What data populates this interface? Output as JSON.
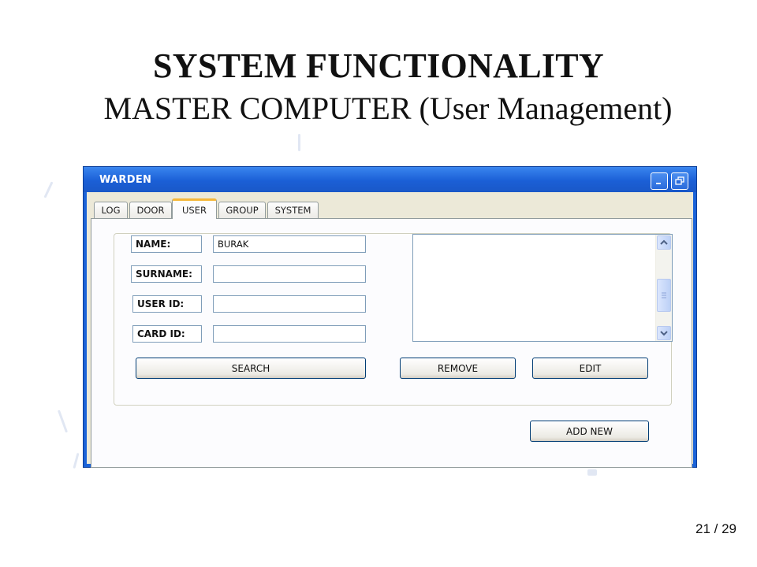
{
  "slide": {
    "title": "SYSTEM FUNCTIONALITY",
    "subtitle": "MASTER COMPUTER (User Management)",
    "page_number": "21 / 29"
  },
  "window": {
    "title": "WARDEN",
    "tabs": [
      {
        "label": "LOG",
        "active": false
      },
      {
        "label": "DOOR",
        "active": false
      },
      {
        "label": "USER",
        "active": true
      },
      {
        "label": "GROUP",
        "active": false
      },
      {
        "label": "SYSTEM",
        "active": false
      }
    ],
    "form": {
      "name_label": "NAME:",
      "name_value": "BURAK",
      "surname_label": "SURNAME:",
      "surname_value": "",
      "user_id_label": "USER ID:",
      "user_id_value": "",
      "card_id_label": "CARD ID:",
      "card_id_value": ""
    },
    "buttons": {
      "search": "SEARCH",
      "remove": "REMOVE",
      "edit": "EDIT",
      "add_new": "ADD NEW"
    },
    "list_items": []
  },
  "colors": {
    "titlebar": "#1b5fd6",
    "client": "#ece9d8",
    "active_tab_accent": "#f5b73a"
  }
}
